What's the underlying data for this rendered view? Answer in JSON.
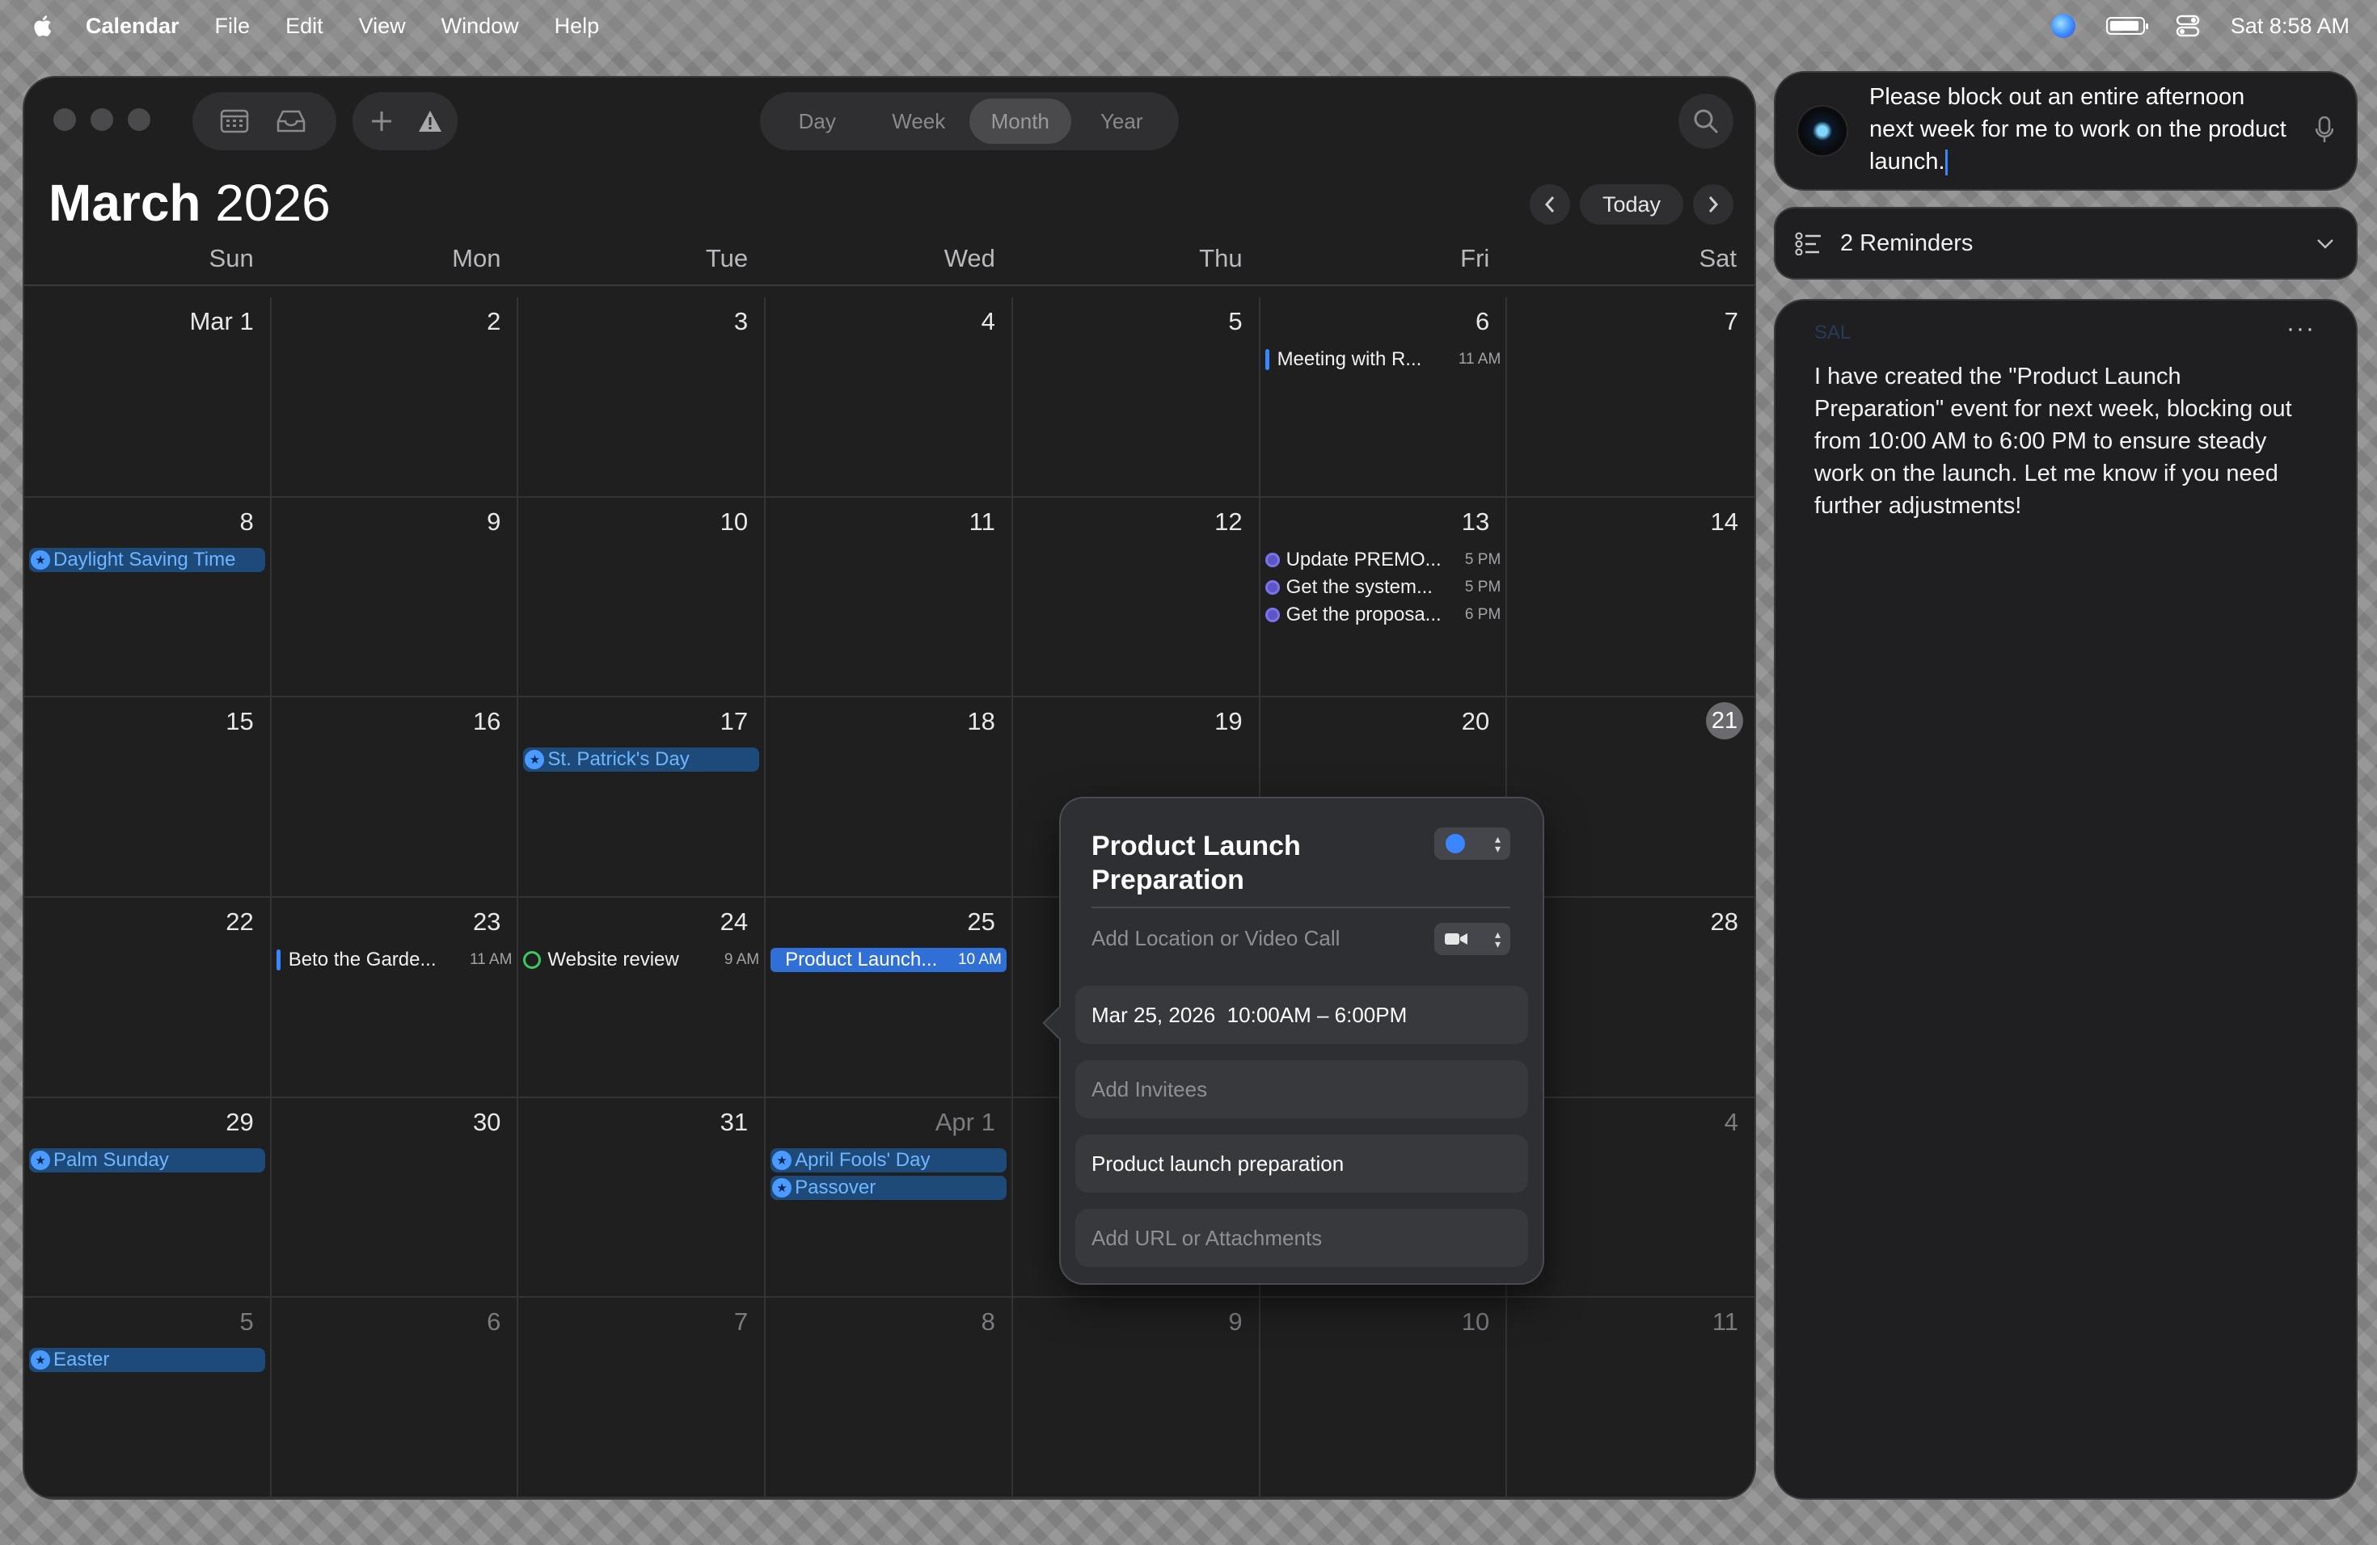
{
  "menubar": {
    "app": "Calendar",
    "items": [
      "File",
      "Edit",
      "View",
      "Window",
      "Help"
    ],
    "clock": "Sat 8:58 AM"
  },
  "toolbar": {
    "views": [
      "Day",
      "Week",
      "Month",
      "Year"
    ],
    "active_view": "Month"
  },
  "header": {
    "month": "March",
    "year": "2026",
    "today_label": "Today"
  },
  "weekdays": [
    "Sun",
    "Mon",
    "Tue",
    "Wed",
    "Thu",
    "Fri",
    "Sat"
  ],
  "days": [
    {
      "label": "Mar 1",
      "dim": false
    },
    {
      "label": "2"
    },
    {
      "label": "3"
    },
    {
      "label": "4"
    },
    {
      "label": "5"
    },
    {
      "label": "6"
    },
    {
      "label": "7"
    },
    {
      "label": "8"
    },
    {
      "label": "9"
    },
    {
      "label": "10"
    },
    {
      "label": "11"
    },
    {
      "label": "12"
    },
    {
      "label": "13"
    },
    {
      "label": "14"
    },
    {
      "label": "15"
    },
    {
      "label": "16"
    },
    {
      "label": "17"
    },
    {
      "label": "18"
    },
    {
      "label": "19"
    },
    {
      "label": "20"
    },
    {
      "label": "21",
      "today": true
    },
    {
      "label": "22"
    },
    {
      "label": "23"
    },
    {
      "label": "24"
    },
    {
      "label": "25"
    },
    {
      "label": "26"
    },
    {
      "label": "27"
    },
    {
      "label": "28"
    },
    {
      "label": "29"
    },
    {
      "label": "30"
    },
    {
      "label": "31"
    },
    {
      "label": "Apr 1",
      "dim": true
    },
    {
      "label": "2",
      "dim": true
    },
    {
      "label": "3",
      "dim": true
    },
    {
      "label": "4",
      "dim": true
    },
    {
      "label": "5",
      "dim": true
    },
    {
      "label": "6",
      "dim": true
    },
    {
      "label": "7",
      "dim": true
    },
    {
      "label": "8",
      "dim": true
    },
    {
      "label": "9",
      "dim": true
    },
    {
      "label": "10",
      "dim": true
    },
    {
      "label": "11",
      "dim": true
    }
  ],
  "events": {
    "meeting": {
      "title": "Meeting with R...",
      "time": "11 AM"
    },
    "dst": {
      "title": "Daylight Saving Time"
    },
    "update": {
      "title": "Update PREMO...",
      "time": "5 PM"
    },
    "get_system": {
      "title": "Get the system...",
      "time": "5 PM"
    },
    "get_proposal": {
      "title": "Get the proposa...",
      "time": "6 PM"
    },
    "st_patrick": {
      "title": "St. Patrick's Day"
    },
    "beto": {
      "title": "Beto the Garde...",
      "time": "11 AM"
    },
    "website": {
      "title": "Website review",
      "time": "9 AM"
    },
    "launch": {
      "title": "Product Launch...",
      "time": "10 AM"
    },
    "palm": {
      "title": "Palm Sunday"
    },
    "april_fools": {
      "title": "April Fools' Day"
    },
    "passover": {
      "title": "Passover"
    },
    "easter": {
      "title": "Easter"
    }
  },
  "popover": {
    "title": "Product Launch Preparation",
    "location_placeholder": "Add Location or Video Call",
    "date": "Mar 25, 2026",
    "time": "10:00AM – 6:00PM",
    "invitees_placeholder": "Add Invitees",
    "notes": "Product launch preparation",
    "url_placeholder": "Add URL or Attachments",
    "color": "#3a86ff"
  },
  "assistant": {
    "prompt": "Please block out an entire afternoon next week for me to work on the product launch.",
    "reminders_label": "2 Reminders",
    "sender": "SAL",
    "more": "···",
    "response": "I have created the \"Product Launch Preparation\" event for next week, blocking out from 10:00 AM to 6:00 PM to ensure steady work on the launch. Let me know if you need further adjustments!"
  }
}
